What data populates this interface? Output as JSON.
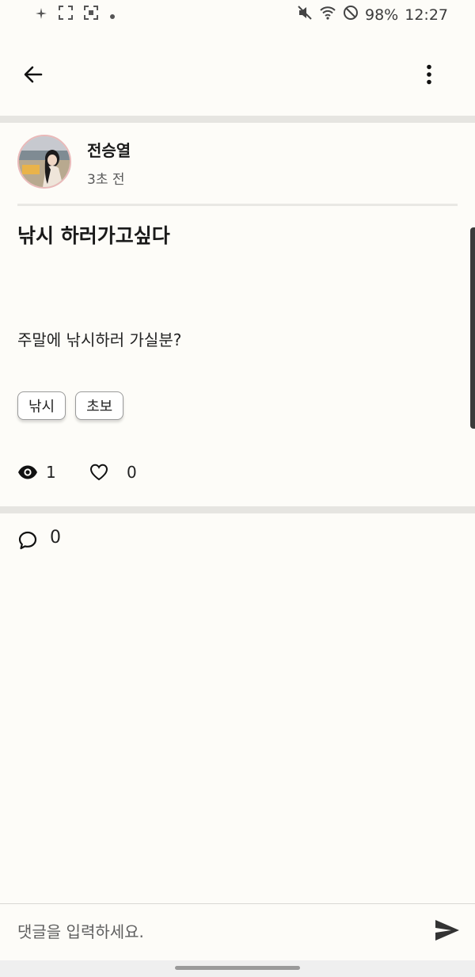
{
  "status_bar": {
    "battery": "98%",
    "time": "12:27"
  },
  "post": {
    "author_name": "전승열",
    "time_ago": "3초 전",
    "title": "낚시 하러가고싶다",
    "body": "주말에 낚시하러 가실분?",
    "tags": [
      "낚시",
      "초보"
    ],
    "views": "1",
    "likes": "0"
  },
  "comments": {
    "count": "0"
  },
  "comment_input": {
    "placeholder": "댓글을 입력하세요."
  },
  "icons": {
    "back": "arrow-left-icon",
    "more": "more-vertical-icon",
    "views": "eye-icon",
    "likes": "heart-outline-icon",
    "comments": "chat-bubble-icon",
    "send": "send-icon"
  },
  "colors": {
    "background": "#fdfcf8",
    "divider": "#e6e5e1",
    "avatar_border": "#e9b9b9",
    "text_primary": "#1a1a1a",
    "text_secondary": "#5a5a5a"
  }
}
